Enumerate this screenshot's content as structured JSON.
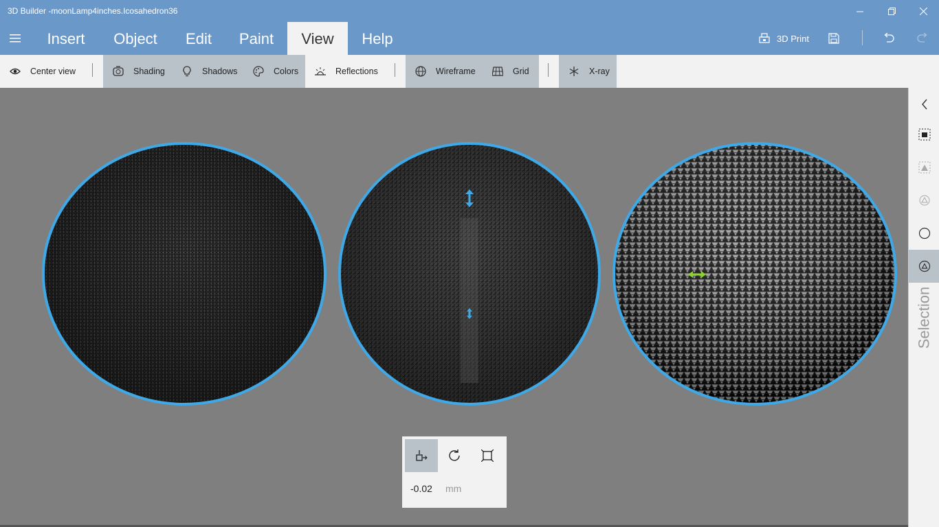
{
  "window": {
    "title": "3D Builder -moonLamp4inches.Icosahedron36",
    "controls": [
      "minimize",
      "restore",
      "close"
    ]
  },
  "menu": {
    "items": [
      {
        "label": "Insert"
      },
      {
        "label": "Object"
      },
      {
        "label": "Edit"
      },
      {
        "label": "Paint"
      },
      {
        "label": "View",
        "active": true
      },
      {
        "label": "Help"
      }
    ],
    "print_label": "3D Print"
  },
  "toolbar": {
    "center_view": "Center view",
    "shading": "Shading",
    "shadows": "Shadows",
    "colors": "Colors",
    "reflections": "Reflections",
    "wireframe": "Wireframe",
    "grid": "Grid",
    "xray": "X-ray",
    "selected": [
      "Shading",
      "Shadows",
      "Colors",
      "Wireframe",
      "Grid",
      "X-ray"
    ]
  },
  "sidebar": {
    "label": "Selection",
    "buttons": [
      "collapse",
      "select-objects",
      "select-faces",
      "select-vertices",
      "select-lasso",
      "select-mesh"
    ]
  },
  "move_panel": {
    "value": "-0.02",
    "unit": "mm",
    "modes": [
      "move",
      "rotate",
      "scale"
    ]
  },
  "colors": {
    "titlebar": "#6a99c9",
    "toolbar": "#f2f2f2",
    "selected": "#b9c1c9",
    "viewport": "#7f7f7f",
    "selection_outline": "#3fa9e8",
    "gizmo_blue": "#3fa9e8",
    "gizmo_green": "#8ed32c"
  },
  "viewport": {
    "objects": [
      "sphere-dense-mesh",
      "sphere-medium-mesh",
      "sphere-triangle-mesh"
    ]
  }
}
